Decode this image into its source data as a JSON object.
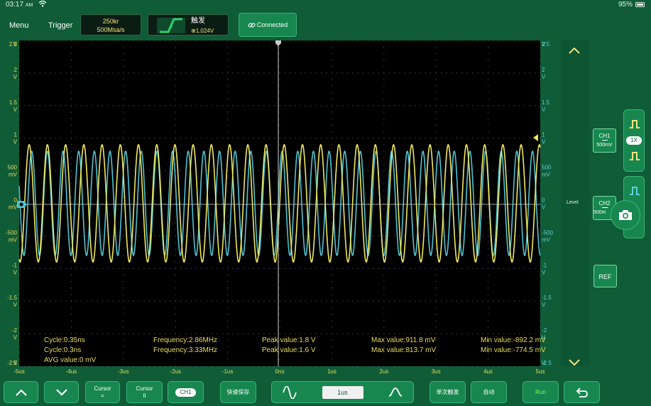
{
  "status_bar": {
    "time": "03:17",
    "ampm": "AM",
    "battery": "95%"
  },
  "top_bar": {
    "menu": "Menu",
    "trigger": "Trigger",
    "timebase_line1": "250kr",
    "timebase_line2": "500Msa/s",
    "trigger_title": "触发",
    "trigger_level": "⊕1.024V",
    "connected": "Connected"
  },
  "y_axis_left": [
    "2.5\nV",
    "2\nV",
    "1.5\nV",
    "1\nV",
    "500\nmV",
    "0\nmV",
    "-500\nmV",
    "-1\nV",
    "-1.5\nV",
    "-2\nV",
    "-2.5\nV"
  ],
  "y_axis_right": [
    "2.5\nV",
    "2\nV",
    "1.5\nV",
    "1\nV",
    "500\nmV",
    "0\nV",
    "-500\nmV",
    "-1\nV",
    "-1.5\nV",
    "-2\nV",
    "-2.5\nV"
  ],
  "x_axis": [
    "-5us",
    "-4us",
    "-3us",
    "-2us",
    "-1us",
    "0ns",
    "1us",
    "2us",
    "3us",
    "4us",
    "5us"
  ],
  "measurements": {
    "cycle1": "Cycle:0.35ns",
    "cycle2": "Cycle:0.3ns",
    "avg": "AVG value:0  mV",
    "freq1": "Frequency:2.86MHz",
    "freq2": "Frequency:3.33MHz",
    "peak1": "Peak value:1.8  V",
    "peak2": "Peak value:1.6  V",
    "max1": "Max value:911.8  mV",
    "max2": "Max value:813.7  mV",
    "min1": "Min value:-892.2  mV",
    "min2": "Min value:-774.5  mV"
  },
  "right_panel": {
    "ch1_name": "CH1",
    "ch1_scale": "500mV",
    "ch2_name": "CH2",
    "ch2_scale": "500m",
    "level": "Level",
    "ref": "REF",
    "probe": "1X"
  },
  "bottom_bar": {
    "cursor_eq": "Cursor",
    "cursor_eq_sub": "=",
    "cursor_par": "Cursor",
    "cursor_par_sub": "II",
    "ch1_toggle": "CH1",
    "quick_save": "快速保存",
    "timebase": "1us",
    "single_trigger": "单次触发",
    "auto": "自动",
    "run": "Run"
  },
  "colors": {
    "ch1": "#f2e95a",
    "ch2": "#4fc3d3",
    "accent": "#17874f",
    "run": "#7dff5a"
  },
  "chart_data": {
    "type": "line",
    "x_unit": "us",
    "xlim": [
      -5,
      5
    ],
    "ylim": [
      -2.5,
      2.5
    ],
    "series": [
      {
        "name": "CH1",
        "frequency_mhz": 2.86,
        "amplitude_v": 0.9,
        "min_v": -0.8922,
        "max_v": 0.9118
      },
      {
        "name": "CH2",
        "frequency_mhz": 3.33,
        "amplitude_v": 0.8,
        "min_v": -0.7745,
        "max_v": 0.8137
      }
    ]
  }
}
